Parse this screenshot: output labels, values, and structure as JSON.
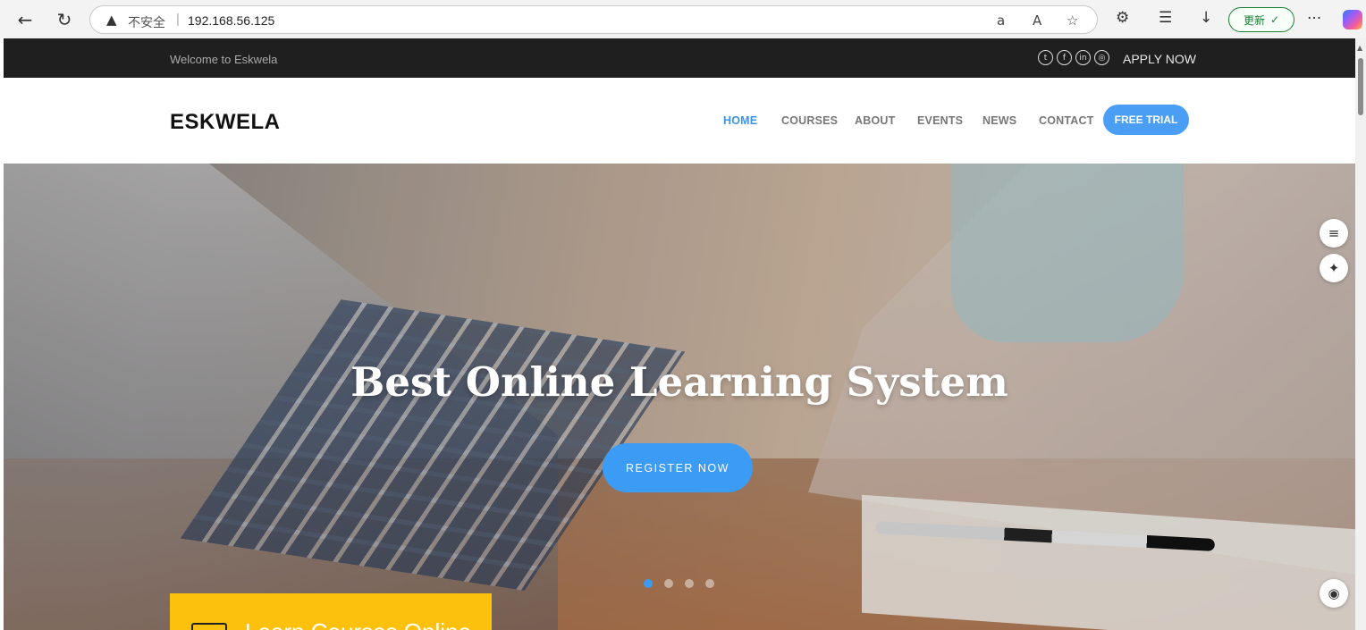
{
  "browser": {
    "back_icon": "arrow-left-icon",
    "refresh_icon": "refresh-icon",
    "security_label": "不安全",
    "url": "192.168.56.125",
    "update_label": "更新",
    "more_label": "···"
  },
  "topbar": {
    "welcome": "Welcome to Eskwela",
    "social_icons": [
      "twitter-icon",
      "facebook-icon",
      "linkedin-icon",
      "instagram-icon"
    ],
    "apply": "APPLY NOW"
  },
  "header": {
    "logo": "ESKWELA",
    "menu": [
      {
        "label": "HOME",
        "active": true
      },
      {
        "label": "COURSES",
        "active": false
      },
      {
        "label": "ABOUT",
        "active": false
      },
      {
        "label": "EVENTS",
        "active": false
      },
      {
        "label": "NEWS",
        "active": false
      },
      {
        "label": "CONTACT",
        "active": false
      }
    ],
    "cta": "FREE TRIAL"
  },
  "hero": {
    "title": "Best Online Learning System",
    "button": "REGISTER NOW",
    "slides": 4,
    "active_slide": 1
  },
  "feature_card": {
    "text": "Learn Courses Online"
  },
  "colors": {
    "accent": "#3b93ea",
    "topbar_bg": "#1f1f1f",
    "card_yellow": "#fcc10d"
  }
}
